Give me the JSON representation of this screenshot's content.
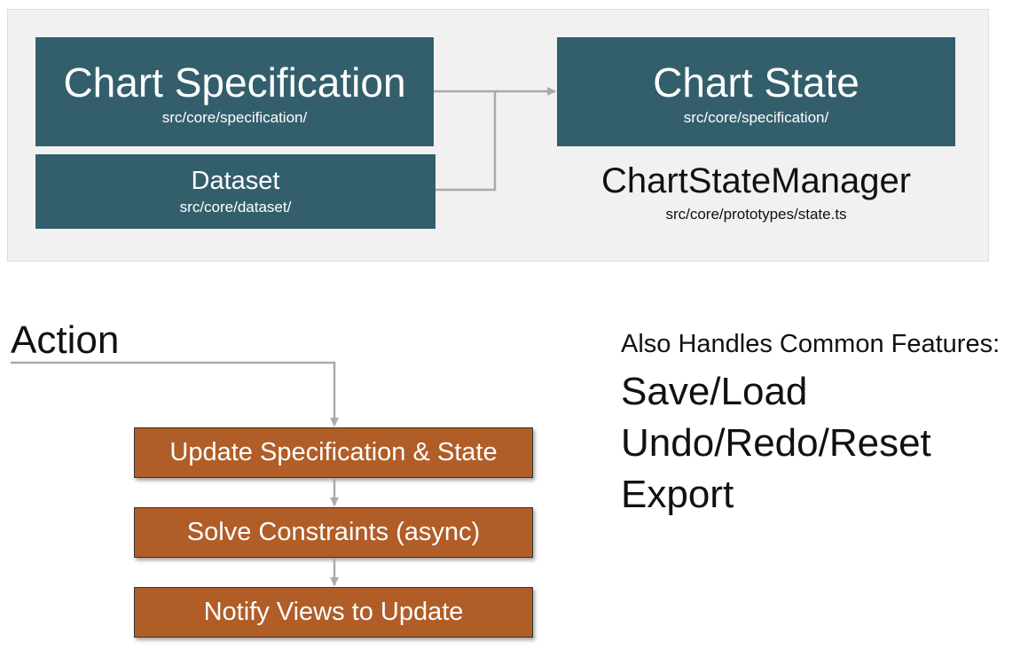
{
  "diagram": {
    "top_panel": {
      "chart_specification": {
        "title": "Chart Specification",
        "path": "src/core/specification/"
      },
      "dataset": {
        "title": "Dataset",
        "path": "src/core/dataset/"
      },
      "chart_state": {
        "title": "Chart State",
        "path": "src/core/specification/"
      },
      "manager": {
        "title": "ChartStateManager",
        "path": "src/core/prototypes/state.ts"
      }
    },
    "action": {
      "label": "Action",
      "steps": [
        "Update Specification & State",
        "Solve Constraints (async)",
        "Notify Views to Update"
      ]
    },
    "features": {
      "heading": "Also Handles Common Features:",
      "items": [
        "Save/Load",
        "Undo/Redo/Reset",
        "Export"
      ]
    }
  },
  "colors": {
    "teal_box": "#335f6c",
    "orange_box": "#b05d28",
    "panel_background": "#f1f1f1",
    "connector": "#aaaaaa"
  }
}
